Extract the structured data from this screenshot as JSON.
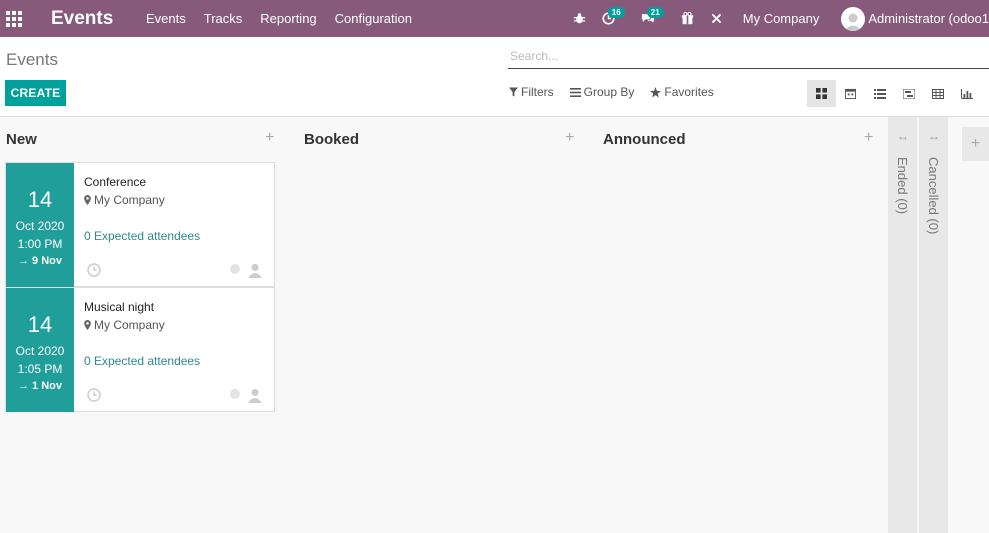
{
  "navbar": {
    "brand": "Events",
    "menu": [
      "Events",
      "Tracks",
      "Reporting",
      "Configuration"
    ],
    "activity_badge": "16",
    "messages_badge": "21",
    "company": "My Company",
    "user": "Administrator (odoo1"
  },
  "control": {
    "breadcrumb": "Events",
    "search_placeholder": "Search...",
    "create_label": "CREATE",
    "filters_label": "Filters",
    "group_by_label": "Group By",
    "favorites_label": "Favorites"
  },
  "columns": [
    {
      "name": "New",
      "add": "+"
    },
    {
      "name": "Booked",
      "add": "+"
    },
    {
      "name": "Announced",
      "add": "+"
    }
  ],
  "folded": [
    {
      "label": "Ended (0)",
      "arrow": "↔"
    },
    {
      "label": "Cancelled (0)",
      "arrow": "↔"
    }
  ],
  "cards": [
    {
      "day": "14",
      "month_year": "Oct 2020",
      "time": "1:00 PM",
      "end": "→ 9 Nov",
      "title": "Conference",
      "location": "My Company",
      "attendees": "0 Expected attendees"
    },
    {
      "day": "14",
      "month_year": "Oct 2020",
      "time": "1:05 PM",
      "end": "→ 1 Nov",
      "title": "Musical night",
      "location": "My Company",
      "attendees": "0 Expected attendees"
    }
  ],
  "colors": {
    "navbar": "#875a7b",
    "primary": "#00a09d",
    "date_bg": "#1f9e9a"
  }
}
